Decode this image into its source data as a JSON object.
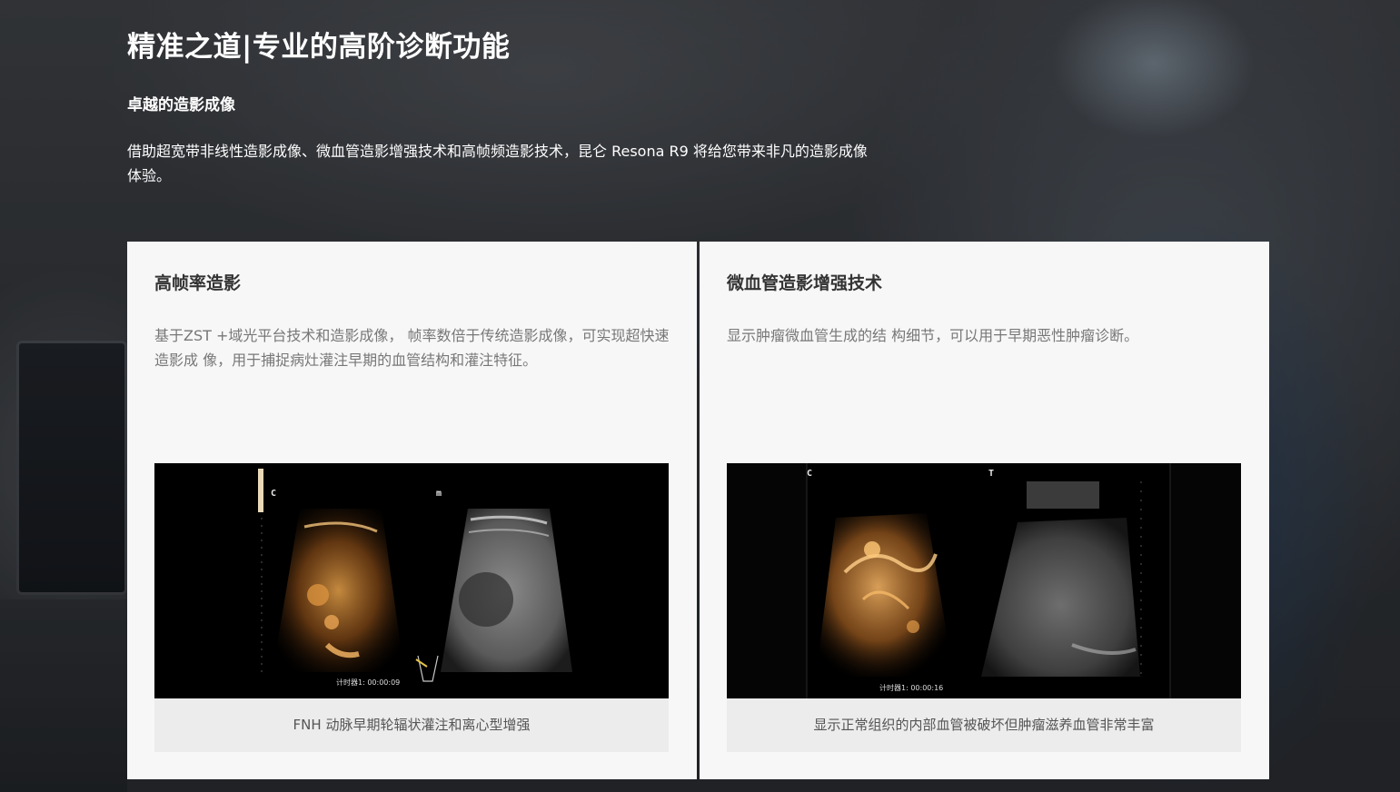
{
  "header": {
    "title": "精准之道|专业的高阶诊断功能",
    "subtitle": "卓越的造影成像",
    "description": "借助超宽带非线性造影成像、微血管造影增强技术和高帧频造影技术，昆仑 Resona R9 将给您带来非凡的造影成像体验。"
  },
  "cards": [
    {
      "title": "高帧率造影",
      "body": "基于ZST +域光平台技术和造影成像， 帧率数倍于传统造影成像，可实现超快速造影成 像，用于捕捉病灶灌注早期的血管结构和灌注特征。",
      "caption": "FNH 动脉早期轮辐状灌注和离心型增强",
      "image": {
        "left_label": "C",
        "right_label": "m",
        "timer": "计时器1: 00:00:09"
      }
    },
    {
      "title": "微血管造影增强技术",
      "body": "显示肿瘤微血管生成的结 构细节，可以用于早期恶性肿瘤诊断。",
      "caption": "显示正常组织的内部血管被破坏但肿瘤滋养血管非常丰富",
      "image": {
        "left_label": "C",
        "right_label": "T",
        "timer": "计时器1: 00:00:16"
      }
    }
  ],
  "colors": {
    "card_background": "#f7f7f7",
    "caption_background": "#ececec",
    "contrast_orange": "#d9923e",
    "body_text": "#777777"
  }
}
